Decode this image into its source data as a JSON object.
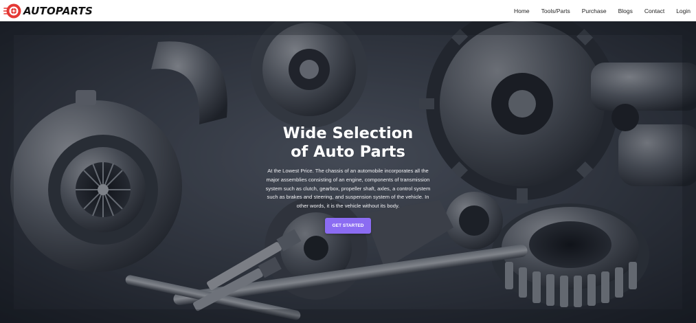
{
  "brand": {
    "name": "AUTOPARTS",
    "logo_icon": "tire-wheel-icon",
    "logo_color": "#e53935"
  },
  "nav": {
    "items": [
      {
        "label": "Home"
      },
      {
        "label": "Tools/Parts"
      },
      {
        "label": "Purchase"
      },
      {
        "label": "Blogs"
      },
      {
        "label": "Contact"
      },
      {
        "label": "Login"
      }
    ]
  },
  "hero": {
    "background": "engine-parts-photo",
    "title": "Wide Selection of Auto Parts",
    "description": "At the Lowest Price. The chassis of an automobile incorporates all the major assemblies consisting of an engine, components of transmission system such as clutch, gearbox, propeller shaft, axles, a control system such as brakes and steering, and suspension system of the vehicle. In other words, it is the vehicle without its body.",
    "cta_label": "GET STARTED",
    "cta_color": "#8b6cf2"
  }
}
